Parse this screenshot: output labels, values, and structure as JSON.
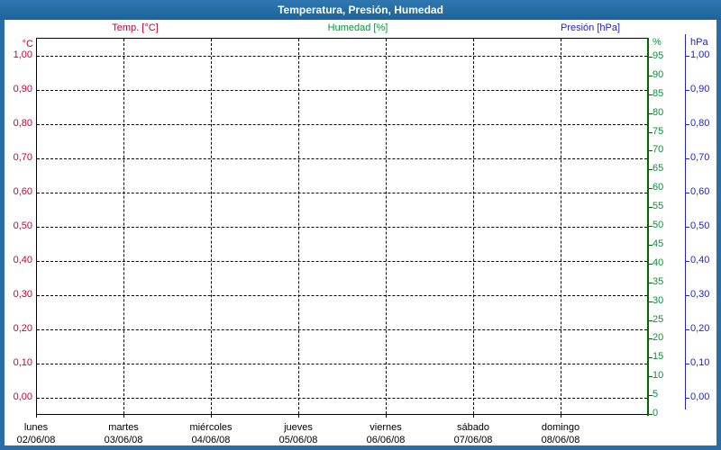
{
  "window": {
    "title": "Temperatura, Presión, Humedad"
  },
  "legend": {
    "temperature": "Temp. [°C]",
    "humidity": "Humedad [%]",
    "pressure": "Presión [hPa]"
  },
  "colors": {
    "temperature": "#cc0033",
    "humidity_text": "#009933",
    "humidity_axis": "#006600",
    "pressure": "#2222cc",
    "frame_blue": "#2b6da7",
    "grid": "#000000",
    "background": "#ffffff"
  },
  "axes": {
    "temperature": {
      "unit": "°C",
      "ticks": [
        "1,00",
        "0,90",
        "0,80",
        "0,70",
        "0,60",
        "0,50",
        "0,40",
        "0,30",
        "0,20",
        "0,10",
        "0,00"
      ]
    },
    "humidity": {
      "unit": "%",
      "ticks": [
        95,
        90,
        85,
        80,
        75,
        70,
        65,
        60,
        55,
        50,
        45,
        40,
        35,
        30,
        25,
        20,
        15,
        10,
        5,
        0
      ]
    },
    "pressure": {
      "unit": "hPa",
      "ticks": [
        "1,00",
        "0,90",
        "0,80",
        "0,70",
        "0,60",
        "0,50",
        "0,40",
        "0,30",
        "0,20",
        "0,10",
        "0,00"
      ]
    }
  },
  "x_axis": {
    "days": [
      {
        "name": "lunes",
        "date": "02/06/08"
      },
      {
        "name": "martes",
        "date": "03/06/08"
      },
      {
        "name": "miércoles",
        "date": "04/06/08"
      },
      {
        "name": "jueves",
        "date": "05/06/08"
      },
      {
        "name": "viernes",
        "date": "06/06/08"
      },
      {
        "name": "sábado",
        "date": "07/06/08"
      },
      {
        "name": "domingo",
        "date": "08/06/08"
      }
    ]
  },
  "chart_data": {
    "type": "line",
    "title": "Temperatura, Presión, Humedad",
    "grid": "dashed",
    "legend_position": "top",
    "x_tick_labels": [
      "lunes 02/06/08",
      "martes 03/06/08",
      "miércoles 04/06/08",
      "jueves 05/06/08",
      "viernes 06/06/08",
      "sábado 07/06/08",
      "domingo 08/06/08"
    ],
    "left_axis": {
      "label": "°C",
      "ticks": [
        "0,00",
        "0,10",
        "0,20",
        "0,30",
        "0,40",
        "0,50",
        "0,60",
        "0,70",
        "0,80",
        "0,90",
        "1,00"
      ]
    },
    "right_inner_axis": {
      "label": "%",
      "min": 0,
      "max": 100,
      "step": 5
    },
    "right_outer_axis": {
      "label": "hPa",
      "ticks": [
        "0,00",
        "0,10",
        "0,20",
        "0,30",
        "0,40",
        "0,50",
        "0,60",
        "0,70",
        "0,80",
        "0,90",
        "1,00"
      ]
    },
    "series": [
      {
        "name": "Temp. [°C]",
        "axis": "left",
        "color": "#cc0033",
        "points": []
      },
      {
        "name": "Humedad [%]",
        "axis": "right-inner",
        "color": "#009933",
        "points": []
      },
      {
        "name": "Presión [hPa]",
        "axis": "right-outer",
        "color": "#2222cc",
        "points": []
      }
    ]
  }
}
